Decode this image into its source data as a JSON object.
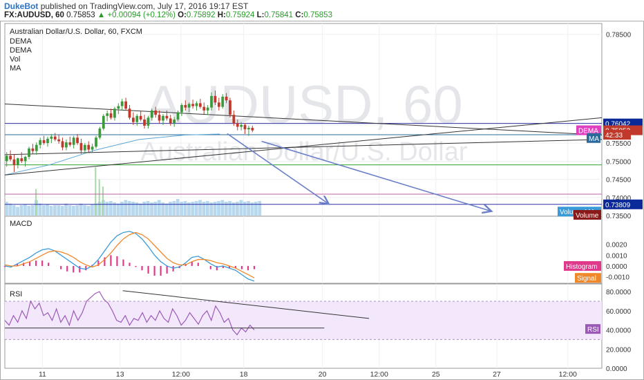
{
  "header": {
    "author": "DukeBot",
    "published": "published on TradingView.com, July 17, 2016 19:17 EST",
    "symbol": "FX:AUDUSD, 60",
    "last": "0.75853",
    "change": "▲ +0.00094 (+0.12%)",
    "o_label": "O:",
    "o_value": "0.75892",
    "h_label": "H:",
    "h_value": "0.75924",
    "l_label": "L:",
    "l_value": "0.75841",
    "c_label": "C:",
    "c_value": "0.75853"
  },
  "colors": {
    "up": "#3b9b3b",
    "down": "#c0392b",
    "macd": "#3a9bd9",
    "signal": "#f0882a",
    "hist": "#e0388a",
    "rsi": "#9b59b6",
    "ma": "#5aa5d6",
    "dema": "#e040c0",
    "blue_line": "#2b2ba8",
    "arrow": "#6a7fc9",
    "trend": "#333333"
  },
  "chart_data": [
    {
      "type": "candlestick",
      "title": "Australian Dollar/U.S. Dollar, 60, FXCM",
      "watermark_symbol": "AUDUSD, 60",
      "watermark_name": "Australian Dollar/U.S. Dollar",
      "legend": [
        "DEMA",
        "DEMA",
        "Vol",
        "MA"
      ],
      "ylim": [
        0.735,
        0.788
      ],
      "yticks": [
        "0.78500",
        "0.76000",
        "0.75500",
        "0.75000",
        "0.74500",
        "0.74000",
        "0.73500"
      ],
      "ytick_values": [
        0.785,
        0.76,
        0.755,
        0.75,
        0.745,
        0.74,
        0.735
      ],
      "labels": [
        {
          "text": "0.76042",
          "y": 0.76042,
          "color": "#0a2a9a"
        },
        {
          "text": "DEMA",
          "y": 0.75853,
          "color": "#e040c0"
        },
        {
          "text": "0.75853",
          "y": 0.75853,
          "color": "#c0392b"
        },
        {
          "text": "42:33",
          "y": 0.7573,
          "color": "#c0392b"
        },
        {
          "text": "MA",
          "y": 0.7564,
          "color": "#2a6a9a"
        },
        {
          "text": "0.73809",
          "y": 0.73809,
          "color": "#0a2a9a"
        },
        {
          "text": "Volume MA",
          "y": 0.7361,
          "color": "#3a9bd9"
        },
        {
          "text": "Volume",
          "y": 0.7352,
          "color": "#8a1a1a"
        }
      ],
      "horizontal_lines": [
        {
          "y": 0.76042,
          "color": "#2b2ba8"
        },
        {
          "y": 0.7573,
          "color": "#2a6a9a"
        },
        {
          "y": 0.749,
          "color": "#2ca02c"
        },
        {
          "y": 0.7409,
          "color": "#c060a0"
        },
        {
          "y": 0.73809,
          "color": "#2b2ba8"
        }
      ],
      "candles": [
        {
          "o": 0.75,
          "h": 0.7525,
          "l": 0.7485,
          "c": 0.7515
        },
        {
          "o": 0.7515,
          "h": 0.753,
          "l": 0.75,
          "c": 0.7505
        },
        {
          "o": 0.7505,
          "h": 0.752,
          "l": 0.747,
          "c": 0.749
        },
        {
          "o": 0.749,
          "h": 0.751,
          "l": 0.748,
          "c": 0.7508
        },
        {
          "o": 0.7508,
          "h": 0.7525,
          "l": 0.7495,
          "c": 0.75
        },
        {
          "o": 0.75,
          "h": 0.7515,
          "l": 0.7485,
          "c": 0.7512
        },
        {
          "o": 0.7512,
          "h": 0.754,
          "l": 0.7505,
          "c": 0.7535
        },
        {
          "o": 0.7535,
          "h": 0.7548,
          "l": 0.752,
          "c": 0.7528
        },
        {
          "o": 0.7528,
          "h": 0.7552,
          "l": 0.7518,
          "c": 0.7545
        },
        {
          "o": 0.7545,
          "h": 0.7565,
          "l": 0.7535,
          "c": 0.7558
        },
        {
          "o": 0.7558,
          "h": 0.757,
          "l": 0.7545,
          "c": 0.755
        },
        {
          "o": 0.755,
          "h": 0.7568,
          "l": 0.754,
          "c": 0.7562
        },
        {
          "o": 0.7562,
          "h": 0.7575,
          "l": 0.755,
          "c": 0.7568
        },
        {
          "o": 0.7568,
          "h": 0.7578,
          "l": 0.7555,
          "c": 0.756
        },
        {
          "o": 0.756,
          "h": 0.7572,
          "l": 0.7548,
          "c": 0.7555
        },
        {
          "o": 0.7555,
          "h": 0.7565,
          "l": 0.753,
          "c": 0.7538
        },
        {
          "o": 0.7538,
          "h": 0.756,
          "l": 0.753,
          "c": 0.7552
        },
        {
          "o": 0.7552,
          "h": 0.7568,
          "l": 0.754,
          "c": 0.7545
        },
        {
          "o": 0.7545,
          "h": 0.757,
          "l": 0.7535,
          "c": 0.7565
        },
        {
          "o": 0.7565,
          "h": 0.7575,
          "l": 0.7545,
          "c": 0.755
        },
        {
          "o": 0.755,
          "h": 0.7562,
          "l": 0.752,
          "c": 0.753
        },
        {
          "o": 0.753,
          "h": 0.755,
          "l": 0.7522,
          "c": 0.7545
        },
        {
          "o": 0.7545,
          "h": 0.7555,
          "l": 0.7525,
          "c": 0.7532
        },
        {
          "o": 0.7532,
          "h": 0.7548,
          "l": 0.7525,
          "c": 0.754
        },
        {
          "o": 0.754,
          "h": 0.757,
          "l": 0.7535,
          "c": 0.7565
        },
        {
          "o": 0.7565,
          "h": 0.7595,
          "l": 0.756,
          "c": 0.759
        },
        {
          "o": 0.759,
          "h": 0.763,
          "l": 0.7585,
          "c": 0.7625
        },
        {
          "o": 0.7625,
          "h": 0.764,
          "l": 0.761,
          "c": 0.7632
        },
        {
          "o": 0.7632,
          "h": 0.7645,
          "l": 0.7615,
          "c": 0.762
        },
        {
          "o": 0.762,
          "h": 0.765,
          "l": 0.7612,
          "c": 0.7645
        },
        {
          "o": 0.7645,
          "h": 0.766,
          "l": 0.763,
          "c": 0.7652
        },
        {
          "o": 0.7652,
          "h": 0.7672,
          "l": 0.764,
          "c": 0.7665
        },
        {
          "o": 0.7665,
          "h": 0.7675,
          "l": 0.764,
          "c": 0.7645
        },
        {
          "o": 0.7645,
          "h": 0.7655,
          "l": 0.7615,
          "c": 0.762
        },
        {
          "o": 0.762,
          "h": 0.7635,
          "l": 0.76,
          "c": 0.7608
        },
        {
          "o": 0.7608,
          "h": 0.763,
          "l": 0.7598,
          "c": 0.7625
        },
        {
          "o": 0.7625,
          "h": 0.764,
          "l": 0.761,
          "c": 0.7615
        },
        {
          "o": 0.7615,
          "h": 0.7628,
          "l": 0.759,
          "c": 0.7598
        },
        {
          "o": 0.7598,
          "h": 0.7625,
          "l": 0.759,
          "c": 0.762
        },
        {
          "o": 0.762,
          "h": 0.7645,
          "l": 0.7612,
          "c": 0.764
        },
        {
          "o": 0.764,
          "h": 0.765,
          "l": 0.762,
          "c": 0.7628
        },
        {
          "o": 0.7628,
          "h": 0.764,
          "l": 0.7605,
          "c": 0.7612
        },
        {
          "o": 0.7612,
          "h": 0.763,
          "l": 0.76,
          "c": 0.7625
        },
        {
          "o": 0.7625,
          "h": 0.764,
          "l": 0.7612,
          "c": 0.7618
        },
        {
          "o": 0.7618,
          "h": 0.7628,
          "l": 0.7598,
          "c": 0.7605
        },
        {
          "o": 0.7605,
          "h": 0.7622,
          "l": 0.7595,
          "c": 0.7615
        },
        {
          "o": 0.7615,
          "h": 0.764,
          "l": 0.761,
          "c": 0.7635
        },
        {
          "o": 0.7635,
          "h": 0.766,
          "l": 0.7625,
          "c": 0.7655
        },
        {
          "o": 0.7655,
          "h": 0.7668,
          "l": 0.764,
          "c": 0.7648
        },
        {
          "o": 0.7648,
          "h": 0.7662,
          "l": 0.7635,
          "c": 0.7658
        },
        {
          "o": 0.7658,
          "h": 0.767,
          "l": 0.7645,
          "c": 0.7652
        },
        {
          "o": 0.7652,
          "h": 0.7665,
          "l": 0.764,
          "c": 0.766
        },
        {
          "o": 0.766,
          "h": 0.7672,
          "l": 0.7645,
          "c": 0.765
        },
        {
          "o": 0.765,
          "h": 0.7662,
          "l": 0.763,
          "c": 0.764
        },
        {
          "o": 0.764,
          "h": 0.7655,
          "l": 0.7628,
          "c": 0.7648
        },
        {
          "o": 0.7648,
          "h": 0.769,
          "l": 0.764,
          "c": 0.768
        },
        {
          "o": 0.768,
          "h": 0.7695,
          "l": 0.7655,
          "c": 0.7662
        },
        {
          "o": 0.7662,
          "h": 0.7675,
          "l": 0.764,
          "c": 0.765
        },
        {
          "o": 0.765,
          "h": 0.7685,
          "l": 0.7645,
          "c": 0.7678
        },
        {
          "o": 0.7678,
          "h": 0.7688,
          "l": 0.766,
          "c": 0.7668
        },
        {
          "o": 0.7668,
          "h": 0.7675,
          "l": 0.762,
          "c": 0.7628
        },
        {
          "o": 0.7628,
          "h": 0.764,
          "l": 0.7598,
          "c": 0.7605
        },
        {
          "o": 0.7605,
          "h": 0.7615,
          "l": 0.7585,
          "c": 0.7595
        },
        {
          "o": 0.7595,
          "h": 0.7608,
          "l": 0.7585,
          "c": 0.76
        },
        {
          "o": 0.76,
          "h": 0.7605,
          "l": 0.7575,
          "c": 0.7588
        },
        {
          "o": 0.7588,
          "h": 0.7598,
          "l": 0.757,
          "c": 0.7592
        },
        {
          "o": 0.7592,
          "h": 0.7598,
          "l": 0.758,
          "c": 0.7585
        }
      ],
      "volumes": [
        40,
        35,
        30,
        25,
        30,
        32,
        28,
        30,
        45,
        35,
        30,
        32,
        28,
        30,
        30,
        28,
        35,
        30,
        28,
        30,
        35,
        30,
        28,
        32,
        35,
        40,
        45,
        40,
        42,
        38,
        35,
        40,
        45,
        42,
        40,
        38,
        35,
        40,
        42,
        38,
        40,
        45,
        38,
        35,
        40,
        42,
        48,
        40,
        42,
        38,
        40,
        42,
        45,
        40,
        42,
        38,
        40,
        42,
        45,
        40,
        42,
        38,
        40,
        45,
        40,
        42,
        38,
        40,
        42
      ],
      "volume_spikes": [
        {
          "i": 24,
          "v": 100
        },
        {
          "i": 25,
          "v": 75
        },
        {
          "i": 26,
          "v": 60
        },
        {
          "i": 8,
          "v": 55
        }
      ],
      "trendlines": [
        {
          "x1": 0.0,
          "y1": 0.7658,
          "x2": 1.0,
          "y2": 0.7572,
          "color": "#333333"
        },
        {
          "x1": 0.0,
          "y1": 0.7462,
          "x2": 1.0,
          "y2": 0.762,
          "color": "#333333"
        },
        {
          "x1": 0.0,
          "y1": 0.7518,
          "x2": 1.0,
          "y2": 0.756,
          "color": "#333333"
        }
      ],
      "ma_line": [
        [
          0.0,
          0.7462
        ],
        [
          0.15,
          0.749
        ],
        [
          0.3,
          0.753
        ],
        [
          0.45,
          0.756
        ],
        [
          0.6,
          0.7572
        ],
        [
          0.72,
          0.7575
        ]
      ],
      "arrows": [
        {
          "x1": 0.745,
          "y1": 0.7576,
          "x2": 1.085,
          "y2": 0.7382
        },
        {
          "x1": 0.86,
          "y1": 0.7555,
          "x2": 1.63,
          "y2": 0.7362
        }
      ]
    },
    {
      "type": "line",
      "title": "MACD",
      "ylim": [
        -0.0016,
        0.0046
      ],
      "yticks": [
        "0.0020",
        "0.0010",
        "0.0000",
        "-0.0010"
      ],
      "ytick_values": [
        0.002,
        0.001,
        0.0,
        -0.001
      ],
      "labels": [
        {
          "text": "Histogram",
          "y": 0.0,
          "color": "#e0388a"
        },
        {
          "text": "Signal",
          "y": -0.0011,
          "color": "#f0882a"
        }
      ],
      "series": [
        {
          "name": "MACD",
          "values": [
            0.0,
            -0.0001,
            0.0002,
            0.0005,
            0.0008,
            0.0012,
            0.0015,
            0.0016,
            0.0014,
            0.001,
            0.0006,
            0.0002,
            -0.0002,
            -0.0003,
            0.0,
            0.0006,
            0.0014,
            0.0022,
            0.0028,
            0.0031,
            0.0032,
            0.003,
            0.0025,
            0.0018,
            0.001,
            0.0004,
            0.0,
            -0.0002,
            -0.0001,
            0.0003,
            0.0008,
            0.0009,
            0.0006,
            0.0002,
            -0.0001,
            0.0,
            -0.0002,
            -0.0004,
            -0.0008,
            -0.0012,
            -0.0014
          ]
        },
        {
          "name": "Signal",
          "values": [
            0.0001,
            0.0,
            0.0,
            0.0002,
            0.0004,
            0.0007,
            0.001,
            0.0013,
            0.0014,
            0.0013,
            0.0011,
            0.0008,
            0.0004,
            0.0001,
            -0.0001,
            0.0001,
            0.0006,
            0.0012,
            0.0019,
            0.0025,
            0.0029,
            0.0031,
            0.0029,
            0.0025,
            0.0019,
            0.0013,
            0.0007,
            0.0003,
            0.0001,
            0.0001,
            0.0004,
            0.0006,
            0.0006,
            0.0005,
            0.0003,
            0.0002,
            0.0,
            -0.0002,
            -0.0005,
            -0.0008,
            -0.0011
          ]
        },
        {
          "name": "Histogram",
          "values": [
            -0.0001,
            -0.0001,
            0.0002,
            0.0003,
            0.0004,
            0.0005,
            0.0005,
            0.0003,
            0.0,
            -0.0003,
            -0.0005,
            -0.0006,
            -0.0006,
            -0.0004,
            0.0001,
            0.0005,
            0.0008,
            0.001,
            0.0009,
            0.0006,
            0.0003,
            -0.0001,
            -0.0004,
            -0.0007,
            -0.0009,
            -0.0009,
            -0.0007,
            -0.0005,
            -0.0002,
            0.0002,
            0.0004,
            0.0003,
            0.0,
            -0.0003,
            -0.0004,
            -0.0002,
            -0.0002,
            -0.0002,
            -0.0003,
            -0.0004,
            -0.0003
          ]
        }
      ]
    },
    {
      "type": "line",
      "title": "RSI",
      "ylim": [
        0,
        88
      ],
      "yticks": [
        "80.0000",
        "60.0000",
        "40.0000",
        "20.0000",
        "0.0000"
      ],
      "ytick_values": [
        80,
        60,
        40,
        20,
        0
      ],
      "band": [
        30,
        70
      ],
      "labels": [
        {
          "text": "RSI",
          "y": 41,
          "color": "#9b59b6"
        }
      ],
      "series": [
        {
          "name": "RSI",
          "values": [
            50,
            45,
            55,
            48,
            60,
            52,
            70,
            62,
            68,
            55,
            58,
            50,
            62,
            48,
            55,
            45,
            60,
            50,
            58,
            70,
            74,
            78,
            80,
            72,
            68,
            60,
            50,
            48,
            55,
            45,
            52,
            50,
            58,
            48,
            55,
            50,
            60,
            52,
            48,
            62,
            55,
            45,
            50,
            58,
            52,
            46,
            55,
            60,
            50,
            65,
            58,
            48,
            52,
            40,
            35,
            42,
            38,
            45,
            40
          ]
        }
      ],
      "trendlines": [
        {
          "x1": 0.395,
          "y1": 81,
          "x2": 1.22,
          "y2": 52,
          "color": "#333333"
        },
        {
          "x1": 0.0,
          "y1": 42,
          "x2": 1.07,
          "y2": 42,
          "color": "#333333"
        }
      ],
      "xticks": [
        "11",
        "13",
        "12:00",
        "18",
        "20",
        "12:00",
        "25",
        "27",
        "12:00"
      ],
      "xtick_pos": [
        0.063,
        0.193,
        0.295,
        0.4,
        0.532,
        0.627,
        0.722,
        0.824,
        0.943
      ]
    }
  ]
}
